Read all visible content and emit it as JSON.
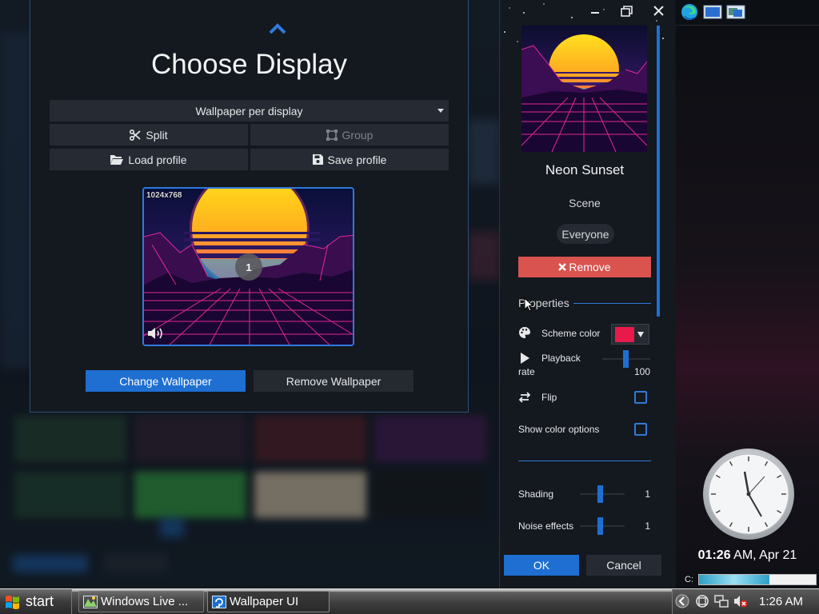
{
  "choose_display": {
    "title": "Choose Display",
    "wallpaper_mode": "Wallpaper per display",
    "split_label": "Split",
    "group_label": "Group",
    "load_profile_label": "Load profile",
    "save_profile_label": "Save profile",
    "monitor": {
      "resolution": "1024x768",
      "number": "1"
    },
    "change_wallpaper_label": "Change Wallpaper",
    "remove_wallpaper_label": "Remove Wallpaper"
  },
  "properties_panel": {
    "wallpaper_title": "Neon Sunset",
    "wallpaper_type": "Scene",
    "rating": "Everyone",
    "remove_label": "Remove",
    "properties_header": "Properties",
    "scheme_color_label": "Scheme color",
    "scheme_color_value": "#e8194b",
    "playback_label": "Playback",
    "playback_rate_label": "rate",
    "playback_rate_value": "100",
    "flip_label": "Flip",
    "flip_checked": false,
    "show_color_options_label": "Show color options",
    "show_color_options_checked": false,
    "shading_label": "Shading",
    "shading_value": "1",
    "noise_label": "Noise effects",
    "noise_value": "1",
    "ok_label": "OK",
    "cancel_label": "Cancel"
  },
  "sidebar": {
    "clock_hour": "01:26",
    "clock_rest": " AM, Apr 21",
    "drive_label": "C:",
    "drive_used_fraction": 0.6
  },
  "taskbar": {
    "start_label": "start",
    "tasks": [
      {
        "label": "Windows Live ...",
        "icon": "windows-live-icon"
      },
      {
        "label": "Wallpaper UI",
        "icon": "wallpaper-ui-icon"
      }
    ],
    "time": "1:26 AM"
  },
  "colors": {
    "accent": "#1e6fd1",
    "danger": "#d9534f",
    "panel_bg": "#14181f"
  }
}
